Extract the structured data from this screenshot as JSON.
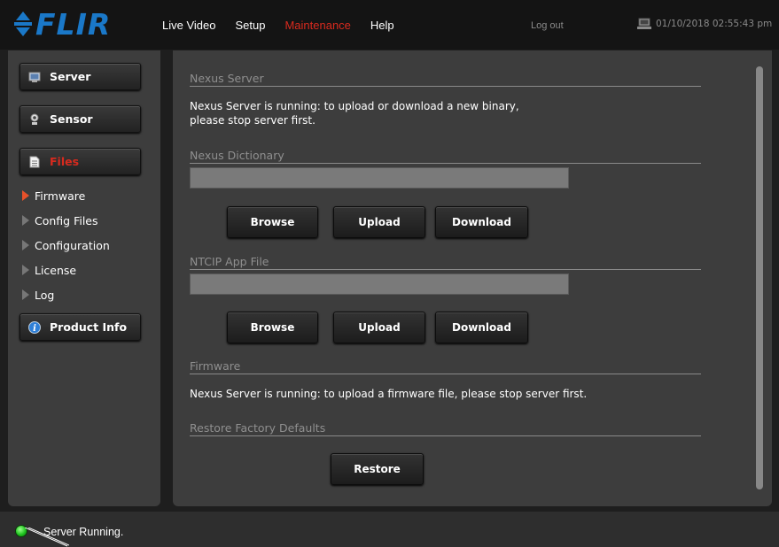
{
  "header": {
    "logo_text": "FLIR",
    "nav": [
      "Live Video",
      "Setup",
      "Maintenance",
      "Help"
    ],
    "active_nav": "Maintenance",
    "logout_label": "Log out",
    "datetime": "01/10/2018 02:55:43 pm"
  },
  "sidebar": {
    "buttons": {
      "server": "Server",
      "sensor": "Sensor",
      "files": "Files",
      "product_info": "Product Info"
    },
    "sub_items": [
      "Firmware",
      "Config Files",
      "Configuration",
      "License",
      "Log"
    ],
    "active_sub_item": "Firmware"
  },
  "main": {
    "nexus_server": {
      "title": "Nexus Server",
      "message": "Nexus Server is running: to upload or download a new binary, please stop server first."
    },
    "nexus_dictionary": {
      "title": "Nexus Dictionary",
      "value": "",
      "browse_label": "Browse",
      "upload_label": "Upload",
      "download_label": "Download"
    },
    "ntcip_app_file": {
      "title": "NTCIP App File",
      "value": "",
      "browse_label": "Browse",
      "upload_label": "Upload",
      "download_label": "Download"
    },
    "firmware": {
      "title": "Firmware",
      "message": "Nexus Server is running: to upload a firmware file, please stop server first."
    },
    "restore": {
      "title": "Restore Factory Defaults",
      "button_label": "Restore"
    }
  },
  "status": {
    "text": "Server Running.",
    "led_color": "#22c422"
  },
  "colors": {
    "accent_red": "#d82a1e",
    "brand_blue": "#1a78c8",
    "panel_bg": "#3d3d3d"
  }
}
